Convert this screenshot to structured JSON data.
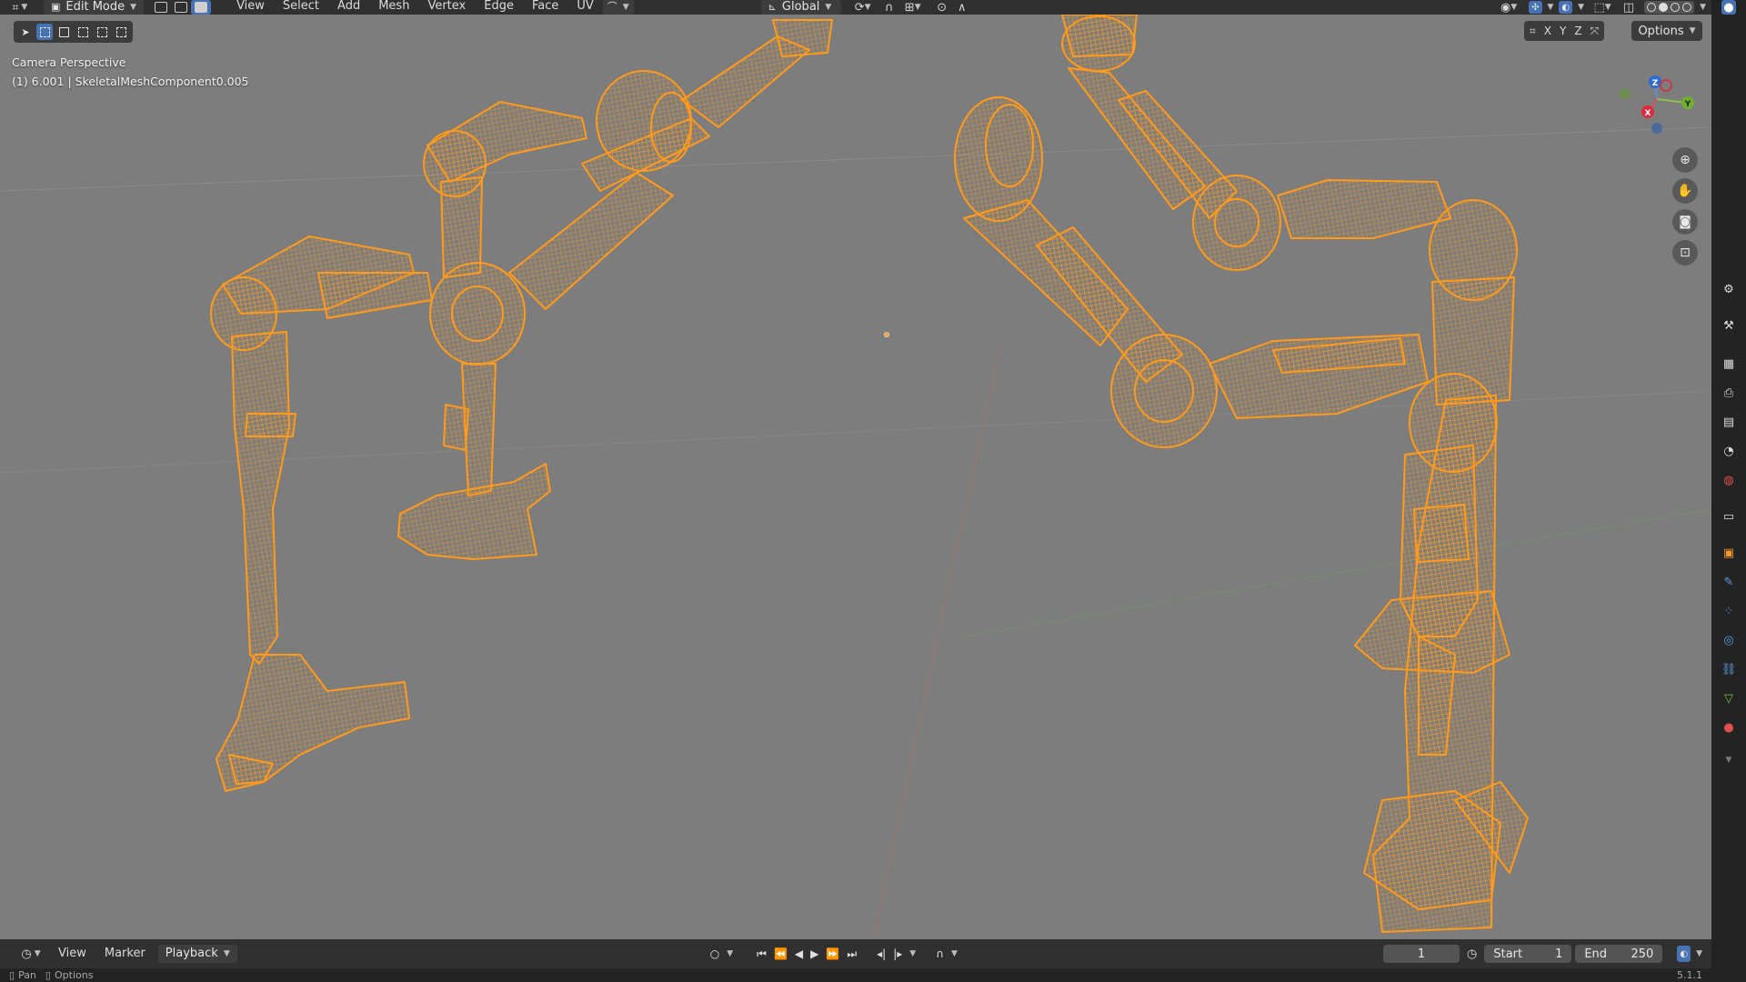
{
  "header": {
    "mode_label": "Edit Mode",
    "menus": [
      "View",
      "Select",
      "Add",
      "Mesh",
      "Vertex",
      "Edge",
      "Face",
      "UV"
    ],
    "transform_orientation": "Global"
  },
  "viewport": {
    "view_name": "Camera Perspective",
    "object_info": "(1) 6.001 | SkeletalMeshComponent0.005",
    "axis_labels": {
      "x": "X",
      "y": "Y",
      "z": "Z"
    },
    "mirror_axes": [
      "X",
      "Y",
      "Z"
    ],
    "options_label": "Options",
    "wire_color": "#ff9a1a",
    "background_color": "#7d7d7d"
  },
  "timeline": {
    "menus": [
      "View",
      "Marker",
      "Playback"
    ],
    "current_frame": "1",
    "start_label": "Start",
    "start_value": "1",
    "end_label": "End",
    "end_value": "250"
  },
  "status_bar": {
    "left_hint": "Pan",
    "right_hint": "Options",
    "version": "5.1.1"
  },
  "icons": {
    "header": [
      "editor-type-icon",
      "mesh-select-vertex-icon",
      "mesh-select-edge-icon",
      "mesh-select-face-icon",
      "pivot-icon",
      "snap-icon",
      "proportional-icon",
      "overlay-icon",
      "xray-icon",
      "shading-solid-icon"
    ],
    "nav": [
      "zoom-icon",
      "pan-hand-icon",
      "camera-view-icon",
      "lock-icon"
    ],
    "properties": [
      "tool-icon",
      "render-icon",
      "output-icon",
      "view-layer-icon",
      "scene-icon",
      "world-icon",
      "collection-icon",
      "object-icon",
      "modifier-icon",
      "particles-icon",
      "physics-icon",
      "constraints-icon",
      "data-icon",
      "material-icon"
    ]
  }
}
